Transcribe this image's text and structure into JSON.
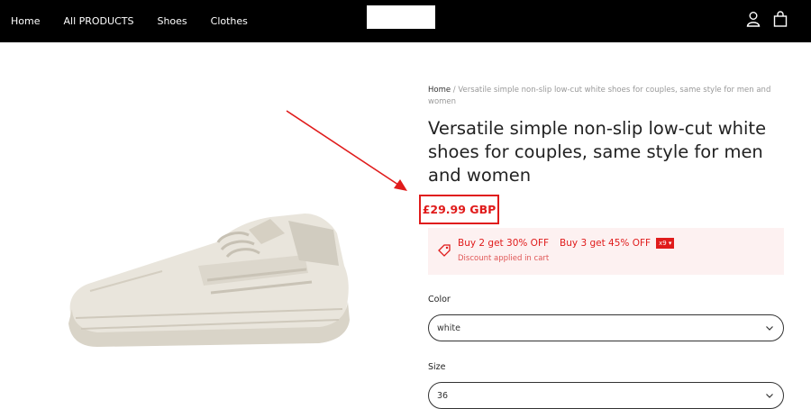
{
  "nav": {
    "items": [
      "Home",
      "All PRODUCTS",
      "Shoes",
      "Clothes"
    ]
  },
  "icons": {
    "account": "user-icon",
    "cart": "bag-icon"
  },
  "breadcrumb": {
    "home": "Home",
    "separator": " / ",
    "current": "Versatile simple non-slip low-cut white shoes for couples, same style for men and women"
  },
  "product": {
    "title": "Versatile simple non-slip low-cut white shoes for couples, same style for men and women",
    "price": "£29.99 GBP"
  },
  "promo": {
    "offer1": "Buy 2 get 30% OFF",
    "offer2": "Buy 3 get 45% OFF",
    "badge": "x9",
    "note": "Discount applied in cart"
  },
  "options": {
    "color_label": "Color",
    "color_value": "white",
    "size_label": "Size",
    "size_value": "36"
  },
  "colors": {
    "accent": "#e01b1b",
    "topbar": "#000000",
    "promo_bg": "#fdf1f1"
  }
}
